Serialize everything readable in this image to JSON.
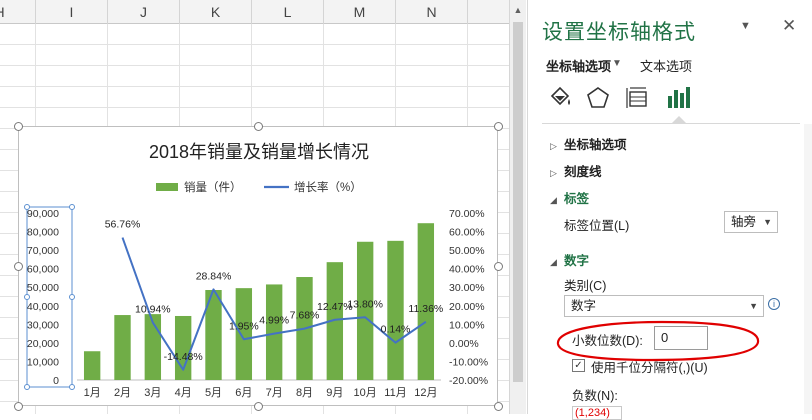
{
  "sheet": {
    "columns": [
      "H",
      "I",
      "J",
      "K",
      "L",
      "M",
      "N"
    ]
  },
  "chart_data": {
    "type": "bar",
    "title": "2018年销量及销量增长情况",
    "categories": [
      "1月",
      "2月",
      "3月",
      "4月",
      "5月",
      "6月",
      "7月",
      "8月",
      "9月",
      "10月",
      "11月",
      "12月"
    ],
    "series": [
      {
        "name": "销量（件）",
        "type": "bar",
        "axis": "primary",
        "color": "#70ad47",
        "values": [
          15500,
          35000,
          35500,
          34500,
          48500,
          49500,
          51500,
          55500,
          63500,
          74500,
          75000,
          84500
        ]
      },
      {
        "name": "增长率（%）",
        "type": "line",
        "axis": "secondary",
        "color": "#4472c4",
        "values": [
          null,
          56.76,
          10.94,
          -14.48,
          28.84,
          1.95,
          4.99,
          7.68,
          12.47,
          13.8,
          0.14,
          11.36
        ]
      }
    ],
    "data_labels": [
      "",
      "56.76%",
      "10.94%",
      "-14.48%",
      "28.84%",
      "1.95%",
      "4.99%",
      "7.68%",
      "12.47%",
      "13.80%",
      "0.14%",
      "11.36%"
    ],
    "y_ticks": [
      "0",
      "10,000",
      "20,000",
      "30,000",
      "40,000",
      "50,000",
      "60,000",
      "70,000",
      "80,000",
      "90,000"
    ],
    "y2_ticks": [
      "-20.00%",
      "-10.00%",
      "0.00%",
      "10.00%",
      "20.00%",
      "30.00%",
      "40.00%",
      "50.00%",
      "60.00%",
      "70.00%"
    ],
    "ylim": [
      0,
      90000
    ],
    "y2lim": [
      -20,
      70
    ],
    "legend_position": "top",
    "grid": false
  },
  "panel": {
    "title": "设置坐标轴格式",
    "dropdown_icon": "chevron-down-icon",
    "close_label": "✕",
    "tab_axis": "坐标轴选项",
    "tab_text": "文本选项",
    "sections": {
      "axis_options": "坐标轴选项",
      "tick_marks": "刻度线",
      "labels": "标签",
      "number": "数字"
    },
    "label_position_label": "标签位置(L)",
    "label_position_value": "轴旁",
    "category_label": "类别(C)",
    "category_value": "数字",
    "decimal_label": "小数位数(D):",
    "decimal_value": "0",
    "thousands_label": "使用千位分隔符(,)(U)",
    "negative_label": "负数(N):",
    "negative_value": "(1,234)",
    "accent_color": "#217346",
    "highlight_color": "#e00000"
  }
}
